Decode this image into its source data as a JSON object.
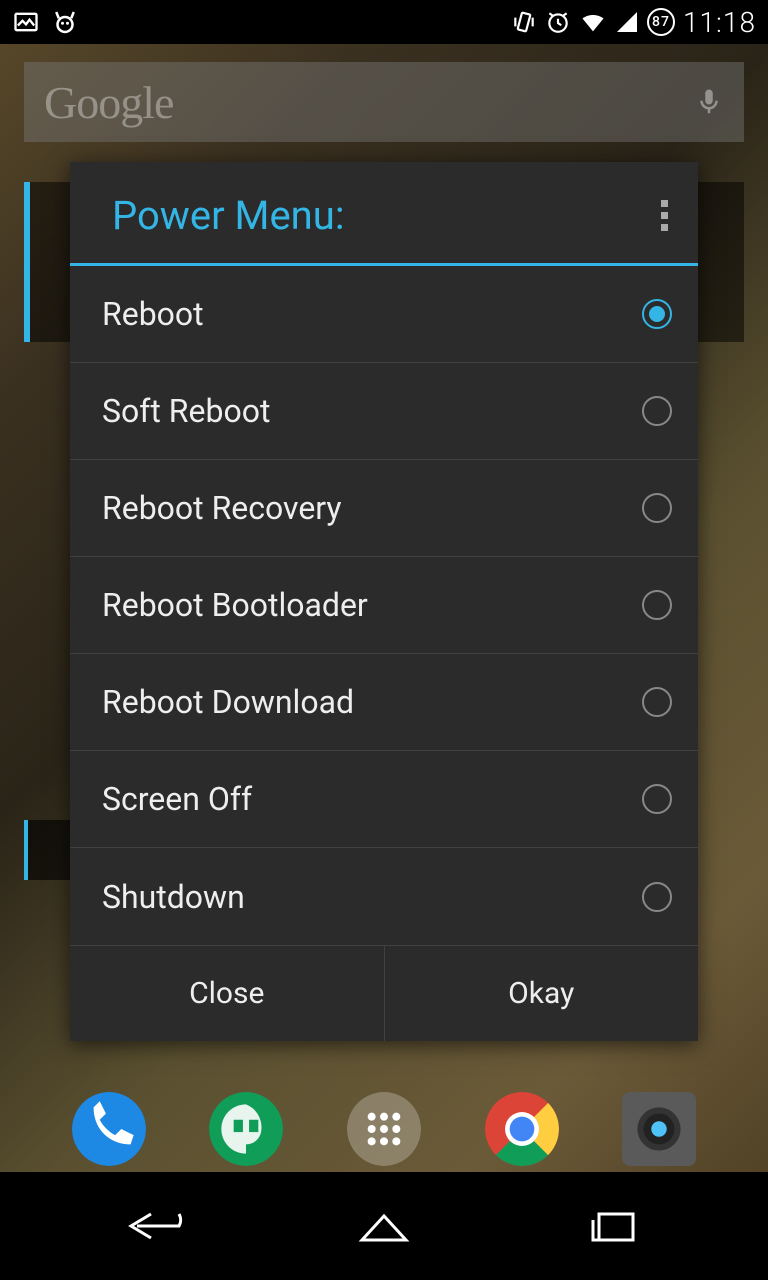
{
  "status": {
    "battery": "87",
    "time": "11:18"
  },
  "search": {
    "placeholder": "Google"
  },
  "dialog": {
    "title": "Power Menu:",
    "options": [
      {
        "label": "Reboot",
        "selected": true
      },
      {
        "label": "Soft Reboot",
        "selected": false
      },
      {
        "label": "Reboot Recovery",
        "selected": false
      },
      {
        "label": "Reboot Bootloader",
        "selected": false
      },
      {
        "label": "Reboot Download",
        "selected": false
      },
      {
        "label": "Screen Off",
        "selected": false
      },
      {
        "label": "Shutdown",
        "selected": false
      }
    ],
    "buttons": {
      "close": "Close",
      "okay": "Okay"
    }
  }
}
